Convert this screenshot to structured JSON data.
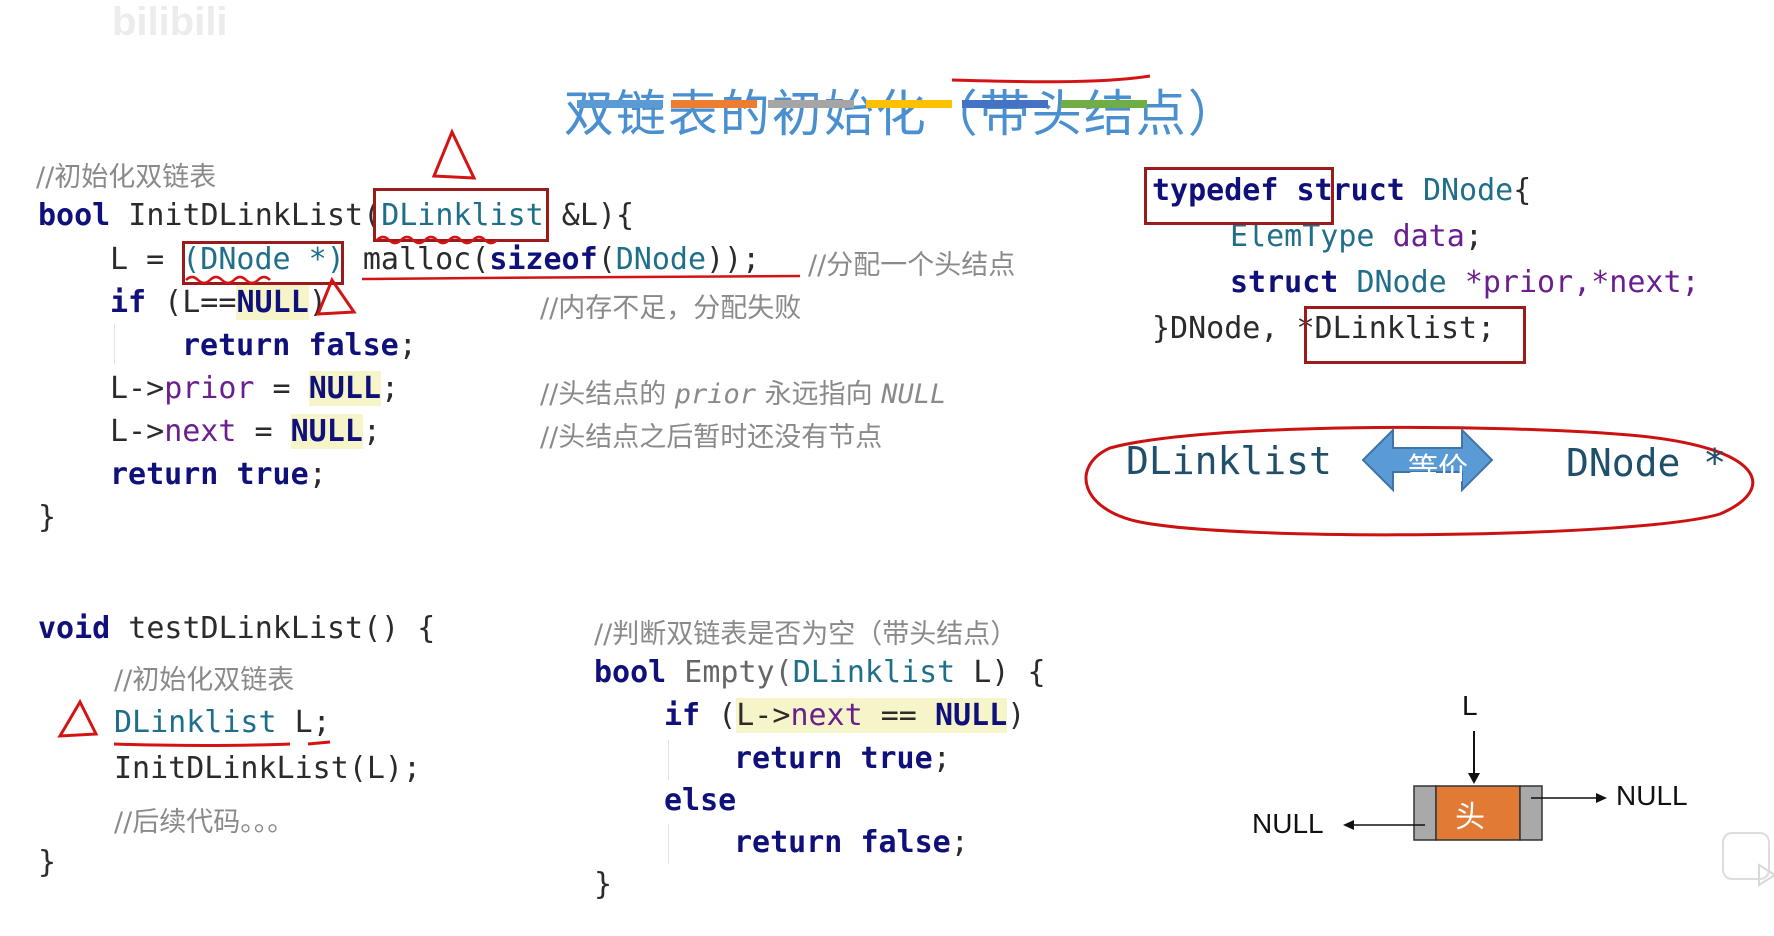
{
  "title": {
    "main": "双链表的初始化（",
    "highlight": "带头结点",
    "end": "）",
    "bar_colors": [
      "#5b9bd5",
      "#ed7d31",
      "#a5a5a5",
      "#ffc000",
      "#4472c4",
      "#70ad47"
    ]
  },
  "watermark": "bilibili",
  "init_func": {
    "comment_head": "//初始化双链表",
    "l1_kw": "bool",
    "l1_a": " InitDLinkList(",
    "l1_param_type": "DLinklist",
    "l1_b": " &L){",
    "l2_a": "L = ",
    "l2_cast": "(DNode *)",
    "l2_b": " malloc(",
    "l2_sizeof": "sizeof",
    "l2_c": "(",
    "l2_type": "DNode",
    "l2_d": "));",
    "l2_comment": "//分配一个头结点",
    "l3_if": "if",
    "l3_a": " (L==",
    "l3_null": "NULL",
    "l3_b": ")",
    "l3_comment": "//内存不足，分配失败",
    "l4_return": "return",
    "l4_false": "false",
    "l4_end": ";",
    "l5_a": "L->",
    "l5_field": "prior",
    "l5_b": " = ",
    "l5_null": "NULL",
    "l5_end": ";",
    "l5_comment_a": "//头结点的 ",
    "l5_comment_prior": "prior",
    "l5_comment_b": " 永远指向 ",
    "l5_comment_null": "NULL",
    "l6_a": "L->",
    "l6_field": "next",
    "l6_b": " = ",
    "l6_null": "NULL",
    "l6_end": ";",
    "l6_comment": "//头结点之后暂时还没有节点",
    "l7_return": "return",
    "l7_true": "true",
    "l7_end": ";",
    "close": "}"
  },
  "typedef": {
    "l1_kw1": "typedef",
    "l1_kw2": "struct",
    "l1_name": "DNode",
    "l1_brace": "{",
    "l2_type": "ElemType",
    "l2_field": "data",
    "l2_end": ";",
    "l3_kw": "struct",
    "l3_type": "DNode",
    "l3_fields": "*prior,*next;",
    "l4_a": "}DNode, ",
    "l4_ptr": "*DLinklist;"
  },
  "equivalence": {
    "left": "DLinklist",
    "arrow_label": "等价",
    "right": "DNode *"
  },
  "test_func": {
    "l1_kw": "void",
    "l1_a": " testDLinkList() {",
    "l2_comment": "//初始化双链表",
    "l3_type": "DLinklist",
    "l3_a": " L;",
    "l4": "InitDLinkList(L);",
    "l5_comment": "//后续代码。。。",
    "close": "}"
  },
  "empty_func": {
    "comment": "//判断双链表是否为空（带头结点）",
    "l1_kw": "bool",
    "l1_name": " Empty(",
    "l1_type": "DLinklist",
    "l1_b": " L) {",
    "l2_if": "if",
    "l2_a": " (",
    "l2_cond_a": "L->",
    "l2_field": "next",
    "l2_cond_b": " == ",
    "l2_null": "NULL",
    "l2_b": ")",
    "l3_return": "return",
    "l3_true": "true",
    "l3_end": ";",
    "l4_else": "else",
    "l5_return": "return",
    "l5_false": "false",
    "l5_end": ";",
    "close": "}"
  },
  "diagram": {
    "pointer_label": "L",
    "node_label": "头",
    "left_null": "NULL",
    "right_null": "NULL",
    "node_color": "#e07a35",
    "side_color": "#a9a9a9"
  }
}
